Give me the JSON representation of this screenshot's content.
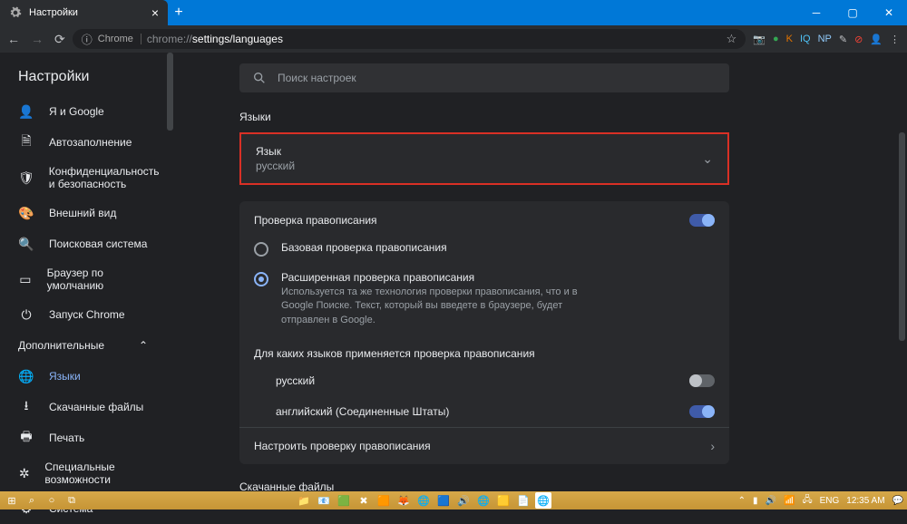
{
  "window": {
    "tab_title": "Настройки",
    "url_prefix": "Chrome",
    "url_scheme": "chrome://",
    "url_path": "settings/languages"
  },
  "extensions": [
    "📷",
    "G",
    "K",
    "IQ",
    "NP",
    "✎",
    "⊘",
    "⋮"
  ],
  "settings_title": "Настройки",
  "search_placeholder": "Поиск настроек",
  "sidebar": {
    "items": [
      {
        "icon": "person",
        "label": "Я и Google"
      },
      {
        "icon": "autofill",
        "label": "Автозаполнение"
      },
      {
        "icon": "security",
        "label": "Конфиденциальность и безопасность"
      },
      {
        "icon": "palette",
        "label": "Внешний вид"
      },
      {
        "icon": "search",
        "label": "Поисковая система"
      },
      {
        "icon": "browser",
        "label": "Браузер по умолчанию"
      },
      {
        "icon": "power",
        "label": "Запуск Chrome"
      }
    ],
    "section_advanced": "Дополнительные",
    "advanced_items": [
      {
        "icon": "globe",
        "label": "Языки",
        "active": true
      },
      {
        "icon": "download",
        "label": "Скачанные файлы"
      },
      {
        "icon": "print",
        "label": "Печать"
      },
      {
        "icon": "accessibility",
        "label": "Специальные возможности"
      },
      {
        "icon": "system",
        "label": "Система"
      }
    ]
  },
  "main": {
    "languages_heading": "Языки",
    "language_row": {
      "title": "Язык",
      "value": "русский"
    },
    "spellcheck_heading": "Проверка правописания",
    "spellcheck_enabled": true,
    "radio_basic": "Базовая проверка правописания",
    "radio_enhanced": "Расширенная проверка правописания",
    "radio_enhanced_desc": "Используется та же технология проверки правописания, что и в Google Поиске. Текст, который вы введете в браузере, будет отправлен в Google.",
    "applies_to_label": "Для каких языков применяется проверка правописания",
    "spell_langs": [
      {
        "name": "русский",
        "on": false
      },
      {
        "name": "английский (Соединенные Штаты)",
        "on": true
      }
    ],
    "customize_label": "Настроить проверку правописания",
    "downloads_heading": "Скачанные файлы"
  },
  "taskbar": {
    "lang": "ENG",
    "time": "12:35 AM"
  }
}
